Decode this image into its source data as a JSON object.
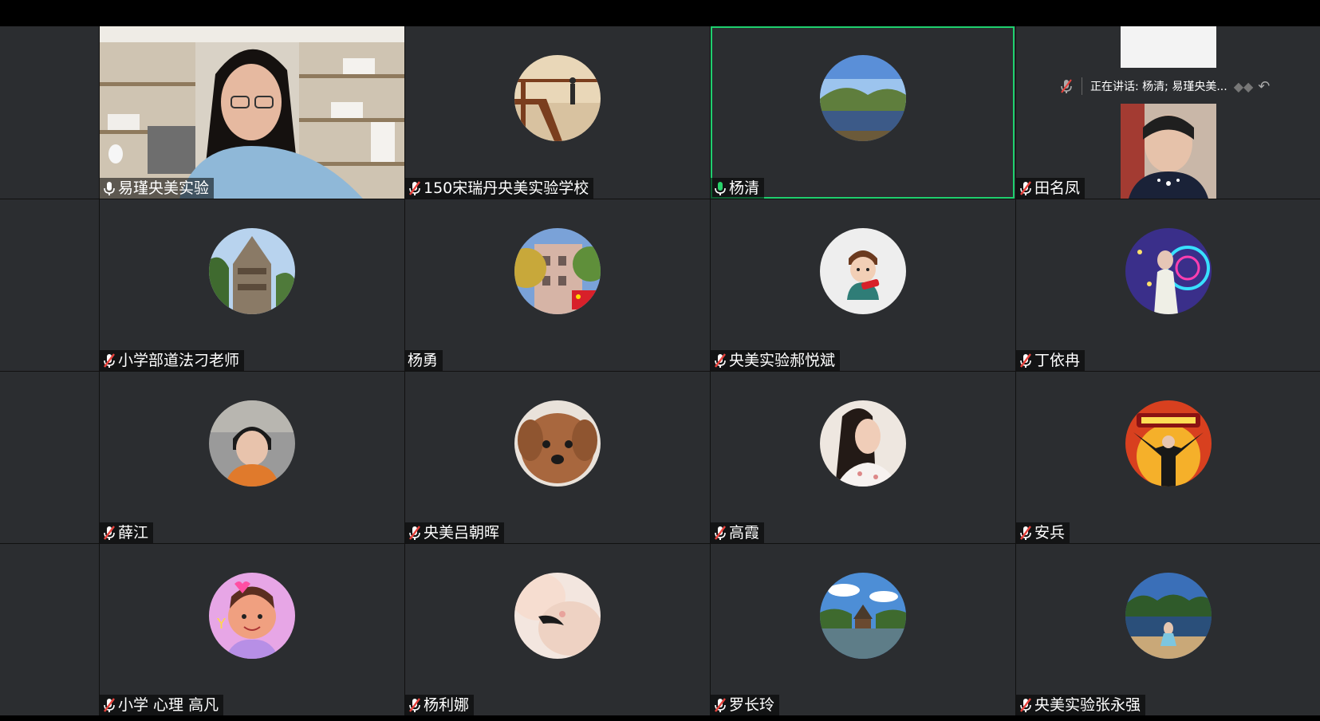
{
  "speaker_bar": {
    "text": "正在讲话: 杨清; 易瑾央美..."
  },
  "colors": {
    "active_border": "#1fcf6e",
    "tile_bg": "#2b2d30",
    "mic_muted": "#e8433d",
    "mic_active": "#29d36b"
  },
  "participants": [
    {
      "name": "易瑾央美实验",
      "mic": "on-white"
    },
    {
      "name": "150宋瑞丹央美实验学校",
      "mic": "muted"
    },
    {
      "name": "杨清",
      "mic": "speaking"
    },
    {
      "name": "田名凤",
      "mic": "muted"
    },
    {
      "name": "小学部道法刁老师",
      "mic": "muted"
    },
    {
      "name": "杨勇",
      "mic": "none"
    },
    {
      "name": "央美实验郝悦斌",
      "mic": "muted"
    },
    {
      "name": "丁依冉",
      "mic": "muted"
    },
    {
      "name": "薛江",
      "mic": "muted"
    },
    {
      "name": "央美吕朝晖",
      "mic": "muted"
    },
    {
      "name": "高霞",
      "mic": "muted"
    },
    {
      "name": "安兵",
      "mic": "muted"
    },
    {
      "name": "小学 心理 高凡",
      "mic": "muted"
    },
    {
      "name": "杨利娜",
      "mic": "muted"
    },
    {
      "name": "罗长玲",
      "mic": "muted"
    },
    {
      "name": "央美实验张永强",
      "mic": "muted"
    }
  ]
}
